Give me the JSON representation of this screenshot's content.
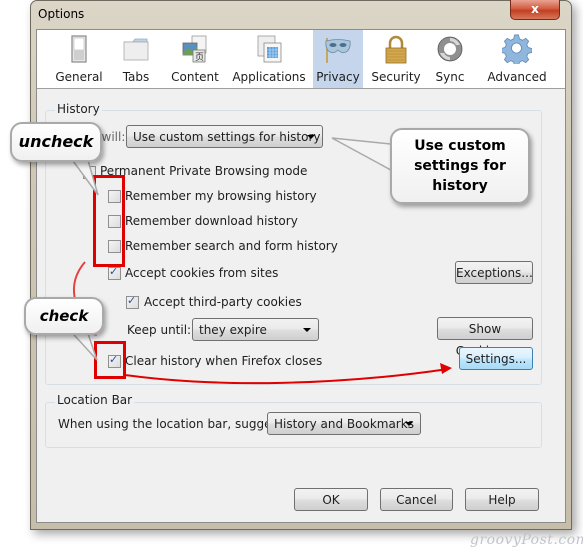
{
  "window": {
    "title": "Options",
    "close_label": "x"
  },
  "toolbar": {
    "items": [
      {
        "label": "General",
        "icon": "switch-icon",
        "selected": false
      },
      {
        "label": "Tabs",
        "icon": "tabs-folder-icon",
        "selected": false
      },
      {
        "label": "Content",
        "icon": "content-page-icon",
        "selected": false
      },
      {
        "label": "Applications",
        "icon": "applications-window-icon",
        "selected": false
      },
      {
        "label": "Privacy",
        "icon": "mask-icon",
        "selected": true
      },
      {
        "label": "Security",
        "icon": "padlock-icon",
        "selected": false
      },
      {
        "label": "Sync",
        "icon": "sync-arrows-icon",
        "selected": false
      },
      {
        "label": "Advanced",
        "icon": "gear-icon",
        "selected": false
      }
    ]
  },
  "history": {
    "group_label": "History",
    "firefox_will_label": "Firefox will:",
    "firefox_will_value": "Use custom settings for history",
    "permanent_private": {
      "label": "Permanent Private Browsing mode",
      "checked": false
    },
    "remember_browsing": {
      "label": "Remember my browsing history",
      "checked": false
    },
    "remember_download": {
      "label": "Remember download history",
      "checked": false
    },
    "remember_search": {
      "label": "Remember search and form history",
      "checked": false
    },
    "accept_cookies": {
      "label": "Accept cookies from sites",
      "checked": true
    },
    "accept_third_party": {
      "label": "Accept third-party cookies",
      "checked": true
    },
    "keep_until_label": "Keep until:",
    "keep_until_value": "they expire",
    "clear_history": {
      "label": "Clear history when Firefox closes",
      "checked": true
    },
    "exceptions_button": "Exceptions...",
    "show_cookies_button": "Show Cookies...",
    "settings_button": "Settings..."
  },
  "location_bar": {
    "group_label": "Location Bar",
    "suggest_label": "When using the location bar, suggest:",
    "suggest_value": "History and Bookmarks"
  },
  "footer": {
    "ok": "OK",
    "cancel": "Cancel",
    "help": "Help"
  },
  "annotations": {
    "uncheck": "uncheck",
    "check": "check",
    "custom_settings_note": "Use custom settings for history",
    "annotation_color": "#e00000"
  },
  "watermark": "groovyPost.com"
}
